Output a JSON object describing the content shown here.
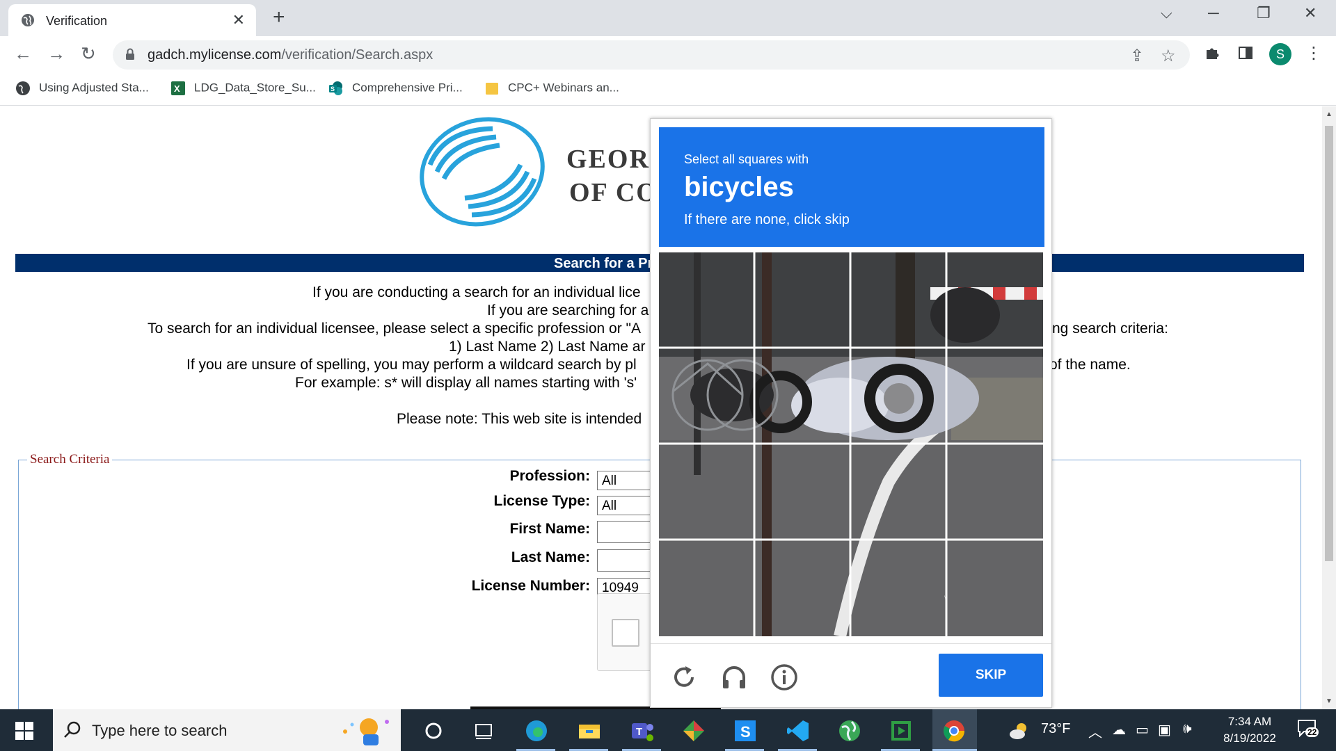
{
  "browser": {
    "tab_title": "Verification",
    "tab_close": "✕",
    "new_tab": "+",
    "url_domain": "gadch.mylicense.com",
    "url_path": "/verification/Search.aspx",
    "profile_initial": "S",
    "bookmarks": [
      {
        "label": "Using Adjusted Sta...",
        "icon": "globe-icon",
        "color": "#3c4043"
      },
      {
        "label": "LDG_Data_Store_Su...",
        "icon": "excel-icon",
        "color": "#1d6f42"
      },
      {
        "label": "Comprehensive Pri...",
        "icon": "sharepoint-icon",
        "color": "#038387"
      },
      {
        "label": "CPC+ Webinars an...",
        "icon": "folder-icon",
        "color": "#f5c542"
      }
    ]
  },
  "page": {
    "org_line1": "GEOR",
    "org_line2": "OF CO",
    "bar_title": "Search for a Pro",
    "intro_lines": [
      "If you are conducting a search for an individual lice",
      "If you are searching for a",
      "To search for an individual licensee, please select a specific profession or \"A",
      "1) Last Name 2) Last Name ar",
      "If you are unsure of spelling, you may perform a wildcard search by pl",
      "For example: s* will display all names starting with 's'",
      "Please note: This web site is intended"
    ],
    "intro_right": [
      "ng search criteria:",
      "of the name."
    ],
    "criteria_legend": "Search Criteria",
    "fields": [
      {
        "label": "Profession:",
        "value": "All"
      },
      {
        "label": "License Type:",
        "value": "All"
      },
      {
        "label": "First Name:",
        "value": ""
      },
      {
        "label": "Last Name:",
        "value": ""
      },
      {
        "label": "License Number:",
        "value": "10949"
      }
    ]
  },
  "captcha": {
    "instruction_small": "Select all squares with",
    "instruction_target": "bicycles",
    "instruction_sub": "If there are none, click skip",
    "skip_label": "SKIP",
    "accent_color": "#1a73e8",
    "footer_icons": [
      "reload-icon",
      "audio-icon",
      "info-icon"
    ]
  },
  "taskbar": {
    "search_placeholder": "Type here to search",
    "weather": "73°F",
    "time": "7:34 AM",
    "date": "8/19/2022",
    "notification_count": "22"
  }
}
